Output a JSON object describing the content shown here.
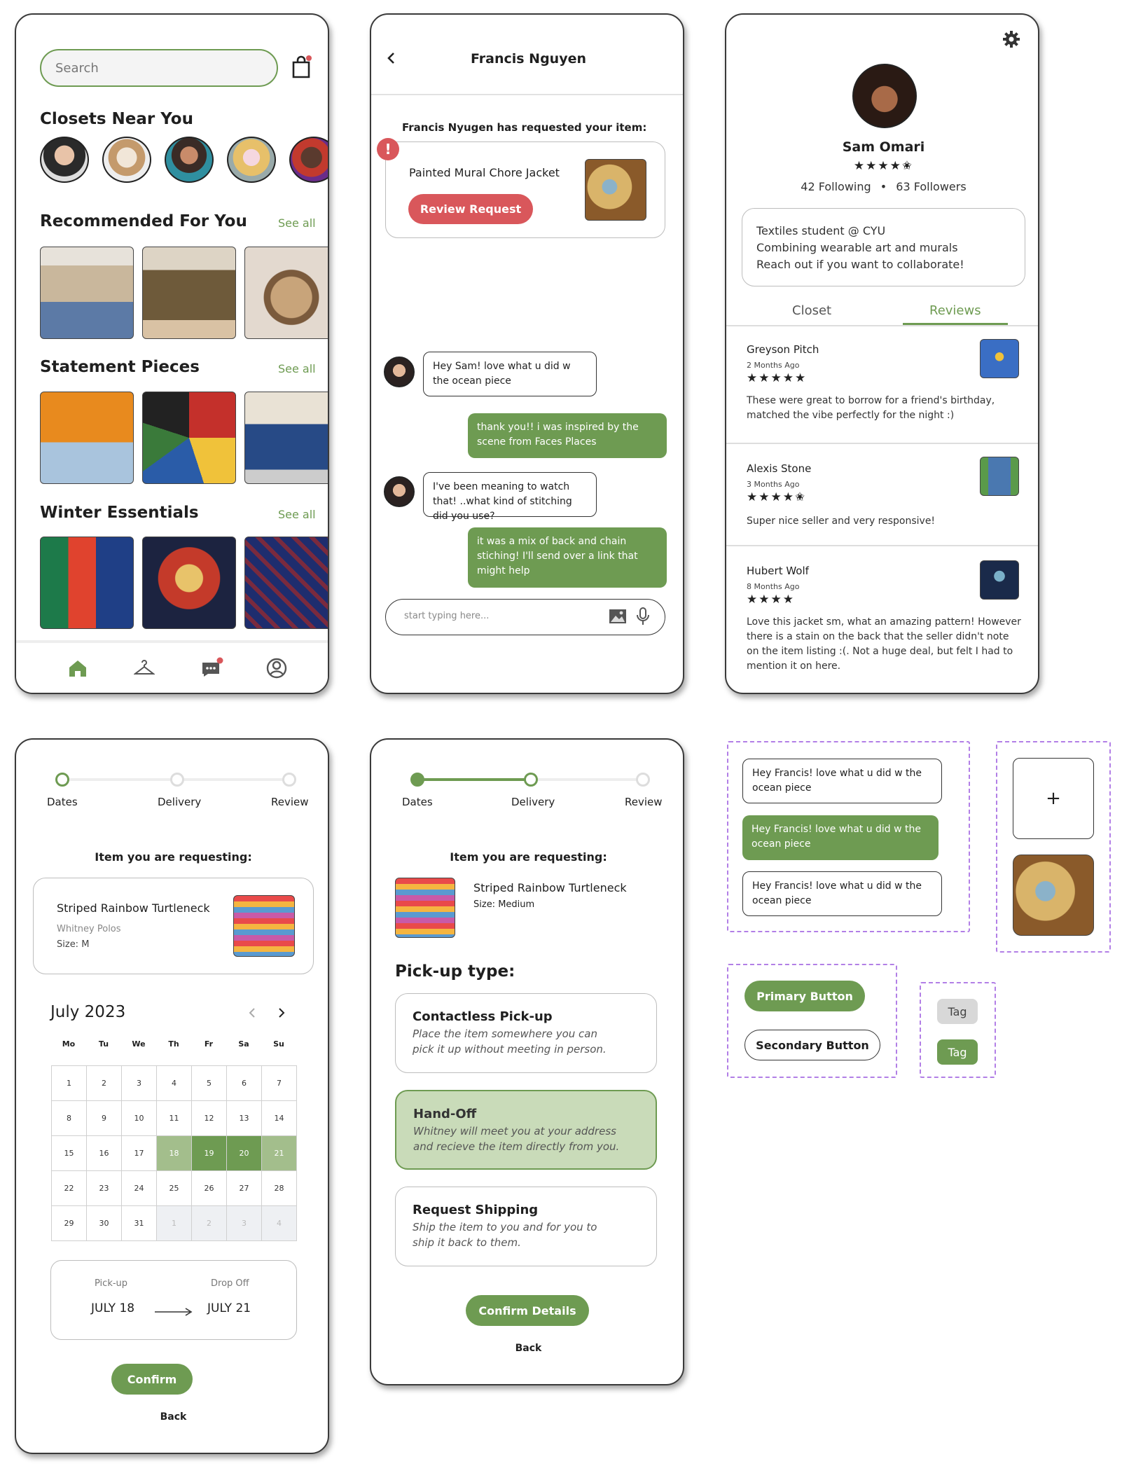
{
  "colors": {
    "accent": "#6e9b52",
    "accent_light": "#c9dbb9",
    "alert": "#d9575b",
    "dashed_frame": "#b27fe6"
  },
  "screen1": {
    "search_placeholder": "Search",
    "closets_title": "Closets Near You",
    "recommended_title": "Recommended For You",
    "statement_title": "Statement Pieces",
    "winter_title": "Winter Essentials",
    "see_all": "See all",
    "nav_icons": [
      "home-icon",
      "hanger-icon",
      "chat-icon",
      "profile-icon"
    ]
  },
  "screen2": {
    "header_name": "Francis Nguyen",
    "request_title": "Francis Nyugen has requested your item:",
    "request_item": "Painted Mural Chore Jacket",
    "review_button": "Review Request",
    "alert_mark": "!",
    "messages": [
      {
        "from": "them",
        "text": "Hey Sam! love what u did w the ocean piece"
      },
      {
        "from": "me",
        "text": "thank you!! i was inspired by the scene from Faces Places"
      },
      {
        "from": "them",
        "text": "I've been meaning to watch that! ..what kind of stitching did you use?"
      },
      {
        "from": "me",
        "text": "it was a mix of back and chain stiching! I'll send over a link that might help"
      }
    ],
    "input_placeholder": "start typing here..."
  },
  "screen3": {
    "name": "Sam Omari",
    "rating": "★★★★✬",
    "following": "42 Following",
    "followers": "63 Followers",
    "bio": [
      "Textiles student @ CYU",
      "Combining wearable art and murals",
      "Reach out if you want to collaborate!"
    ],
    "tabs": [
      "Closet",
      "Reviews"
    ],
    "reviews": [
      {
        "name": "Greyson Pitch",
        "time": "2 Months Ago",
        "stars": "★★★★★",
        "text": "These were great to borrow for a friend's birthday, matched the vibe perfectly for the night :)"
      },
      {
        "name": "Alexis Stone",
        "time": "3 Months Ago",
        "stars": "★★★★✬",
        "text": "Super nice seller and very responsive!"
      },
      {
        "name": "Hubert Wolf",
        "time": "8 Months Ago",
        "stars": "★★★★",
        "text": "Love this jacket sm, what an amazing pattern! However there is a stain on the back that the seller didn't note on the item listing :(. Not a huge deal, but felt I had to mention it on here."
      }
    ]
  },
  "screen4": {
    "steps": [
      "Dates",
      "Delivery",
      "Review"
    ],
    "requesting_label": "Item you are requesting:",
    "item_name": "Striped Rainbow Turtleneck",
    "item_seller": "Whitney Polos",
    "item_size": "Size: M",
    "month": "July 2023",
    "weekdays": [
      "Mo",
      "Tu",
      "We",
      "Th",
      "Fr",
      "Sa",
      "Su"
    ],
    "weeks": [
      [
        "1",
        "2",
        "3",
        "4",
        "5",
        "6",
        "7"
      ],
      [
        "8",
        "9",
        "10",
        "11",
        "12",
        "13",
        "14"
      ],
      [
        "15",
        "16",
        "17",
        "18",
        "19",
        "20",
        "21"
      ],
      [
        "22",
        "23",
        "24",
        "25",
        "26",
        "27",
        "28"
      ],
      [
        "29",
        "30",
        "31",
        "1",
        "2",
        "3",
        "4"
      ]
    ],
    "pickup_label": "Pick-up",
    "dropoff_label": "Drop Off",
    "pickup_date": "JULY 18",
    "dropoff_date": "JULY 21",
    "confirm": "Confirm",
    "back": "Back"
  },
  "screen5": {
    "steps": [
      "Dates",
      "Delivery",
      "Review"
    ],
    "requesting_label": "Item you are requesting:",
    "item_name": "Striped Rainbow Turtleneck",
    "item_size": "Size: Medium",
    "pickup_title": "Pick-up type:",
    "options": [
      {
        "title": "Contactless Pick-up",
        "desc": "Place the item somewhere you can pick it up without meeting in person."
      },
      {
        "title": "Hand-Off",
        "desc": "Whitney will meet you at your address and recieve the item directly from you."
      },
      {
        "title": "Request Shipping",
        "desc": "Ship the item to you and for you to ship it back to them."
      }
    ],
    "confirm": "Confirm Details",
    "back": "Back"
  },
  "components": {
    "bubble_text": "Hey Francis! love what u did w the ocean piece",
    "plus": "+",
    "primary": "Primary Button",
    "secondary": "Secondary Button",
    "tag": "Tag"
  }
}
